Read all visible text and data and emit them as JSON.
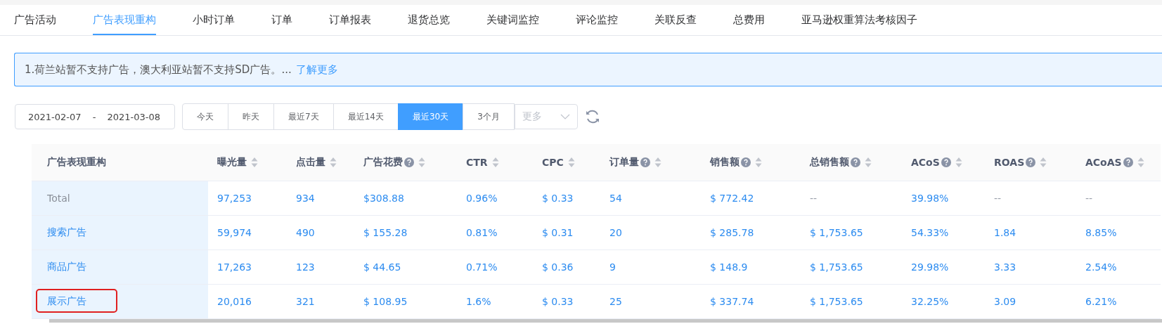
{
  "tabs": [
    {
      "label": "广告活动",
      "selected": false
    },
    {
      "label": "广告表现重构",
      "selected": true
    },
    {
      "label": "小时订单",
      "selected": false
    },
    {
      "label": "订单",
      "selected": false
    },
    {
      "label": "订单报表",
      "selected": false
    },
    {
      "label": "退货总览",
      "selected": false
    },
    {
      "label": "关键词监控",
      "selected": false
    },
    {
      "label": "评论监控",
      "selected": false
    },
    {
      "label": "关联反查",
      "selected": false
    },
    {
      "label": "总费用",
      "selected": false
    },
    {
      "label": "亚马逊权重算法考核因子",
      "selected": false
    }
  ],
  "notice": {
    "text": "1.荷兰站暂不支持广告，澳大利亚站暂不支持SD广告。...",
    "link": "了解更多"
  },
  "date_range": {
    "start": "2021-02-07",
    "separator": "-",
    "end": "2021-03-08"
  },
  "quick_ranges": [
    {
      "label": "今天",
      "selected": false
    },
    {
      "label": "昨天",
      "selected": false
    },
    {
      "label": "最近7天",
      "selected": false
    },
    {
      "label": "最近14天",
      "selected": false
    },
    {
      "label": "最近30天",
      "selected": true
    },
    {
      "label": "3个月",
      "selected": false
    }
  ],
  "more_select": {
    "placeholder": "更多"
  },
  "table": {
    "columns": [
      {
        "label": "广告表现重构",
        "help": false,
        "sortable": false
      },
      {
        "label": "曝光量",
        "help": false,
        "sortable": true
      },
      {
        "label": "点击量",
        "help": false,
        "sortable": true
      },
      {
        "label": "广告花费",
        "help": true,
        "sortable": true
      },
      {
        "label": "CTR",
        "help": false,
        "sortable": true
      },
      {
        "label": "CPC",
        "help": false,
        "sortable": true
      },
      {
        "label": "订单量",
        "help": true,
        "sortable": true
      },
      {
        "label": "销售额",
        "help": true,
        "sortable": true
      },
      {
        "label": "总销售额",
        "help": true,
        "sortable": true
      },
      {
        "label": "ACoS",
        "help": true,
        "sortable": true
      },
      {
        "label": "ROAS ",
        "help": true,
        "sortable": true
      },
      {
        "label": "ACoAS",
        "help": true,
        "sortable": true
      }
    ],
    "rows": [
      {
        "kind": "total",
        "marked": false,
        "cells": [
          "Total",
          "97,253",
          "934",
          "$308.88",
          "0.96%",
          "$ 0.33",
          "54",
          "$ 772.42",
          {
            "kind": "empty",
            "text": "--"
          },
          "39.98%",
          {
            "kind": "empty",
            "text": "--"
          },
          {
            "kind": "empty",
            "text": "--"
          }
        ]
      },
      {
        "kind": "link",
        "marked": false,
        "cells": [
          "搜索广告",
          "59,974",
          "490",
          "$ 155.28",
          "0.81%",
          "$ 0.31",
          "20",
          "$ 285.78",
          "$ 1,753.65",
          "54.33%",
          "1.84",
          "8.85%"
        ]
      },
      {
        "kind": "link",
        "marked": false,
        "cells": [
          "商品广告",
          "17,263",
          "123",
          "$ 44.65",
          "0.71%",
          "$ 0.36",
          "9",
          "$ 148.9",
          "$ 1,753.65",
          "29.98%",
          "3.33",
          "2.54%"
        ]
      },
      {
        "kind": "link",
        "marked": true,
        "cells": [
          "展示广告",
          "20,016",
          "321",
          "$ 108.95",
          "1.6%",
          "$ 0.33",
          "25",
          "$ 337.74",
          "$ 1,753.65",
          "32.25%",
          "3.09",
          "6.21%"
        ]
      }
    ]
  }
}
